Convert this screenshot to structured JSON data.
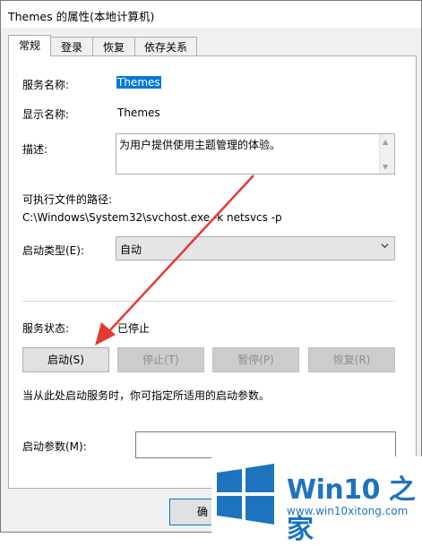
{
  "window": {
    "title": "Themes 的属性(本地计算机)"
  },
  "tabs": [
    {
      "label": "常规",
      "active": true
    },
    {
      "label": "登录",
      "active": false
    },
    {
      "label": "恢复",
      "active": false
    },
    {
      "label": "依存关系",
      "active": false
    }
  ],
  "general": {
    "service_name_label": "服务名称:",
    "service_name_value": "Themes",
    "display_name_label": "显示名称:",
    "display_name_value": "Themes",
    "description_label": "描述:",
    "description_value": "为用户提供使用主题管理的体验。",
    "exe_path_label": "可执行文件的路径:",
    "exe_path_value": "C:\\Windows\\System32\\svchost.exe -k netsvcs -p",
    "startup_type_label": "启动类型(E):",
    "startup_type_value": "自动",
    "service_status_label": "服务状态:",
    "service_status_value": "已停止",
    "buttons": {
      "start": "启动(S)",
      "stop": "停止(T)",
      "pause": "暂停(P)",
      "resume": "恢复(R)"
    },
    "hint": "当从此处启动服务时，你可指定所适用的启动参数。",
    "start_params_label": "启动参数(M):",
    "start_params_value": ""
  },
  "footer": {
    "ok_label": "确"
  },
  "watermark": {
    "title": "Win10 之家",
    "url": "www.win10xitong.com",
    "accent_color": "#1e73be"
  },
  "annotation": {
    "arrow_color": "#e53935"
  }
}
